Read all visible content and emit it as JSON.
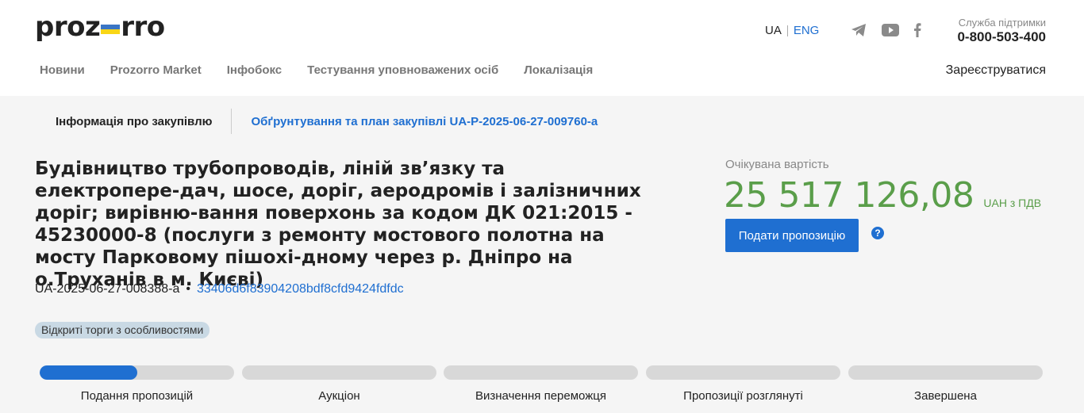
{
  "header": {
    "logo": {
      "left": "proz",
      "right": "rro",
      "flag_top": "#3a75c4",
      "flag_bottom": "#f9d616"
    },
    "lang": {
      "ua": "UA",
      "eng": "ENG"
    },
    "social_icons": [
      "telegram-icon",
      "youtube-icon",
      "facebook-icon"
    ],
    "support": {
      "label": "Служба підтримки",
      "phone": "0-800-503-400"
    },
    "nav": [
      "Новини",
      "Prozorro Market",
      "Інфобокс",
      "Тестування уповноважених осіб",
      "Локалізація"
    ],
    "register": "Зареєструватися"
  },
  "tabs": {
    "info": "Інформація про закупівлю",
    "plan": "Обґрунтування та план закупівлі UA-P-2025-06-27-009760-a"
  },
  "tender": {
    "title": "Будівництво трубопроводів, ліній зв’язку та електропере-дач, шосе, доріг, аеродромів і залізничних доріг; вирівню-вання поверхонь за кодом ДК 021:2015 - 45230000-8 (послуги з ремонту мостового полотна на мосту Парковому пішохі-дному через р. Дніпро на о.Труханів в м. Києві)",
    "id": "UA-2025-06-27-008388-a",
    "dot": "•",
    "hash": "33406d6f83904208bdf8cfd9424fdfdc",
    "badge": "Відкриті торги з особливостями"
  },
  "price": {
    "label": "Очікувана вартість",
    "amount": "25 517 126,08",
    "currency": "UAH з ПДВ",
    "submit": "Подати пропозицію",
    "help": "?"
  },
  "stages": [
    {
      "label": "Подання пропозицій",
      "progress": 0.5
    },
    {
      "label": "Аукціон",
      "progress": 0
    },
    {
      "label": "Визначення переможця",
      "progress": 0
    },
    {
      "label": "Пропозиції розглянуті",
      "progress": 0
    },
    {
      "label": "Завершена",
      "progress": 0
    }
  ],
  "colors": {
    "accent": "#1f6fd1",
    "price": "#5a9e4a",
    "badge": "#c9d9e4"
  }
}
